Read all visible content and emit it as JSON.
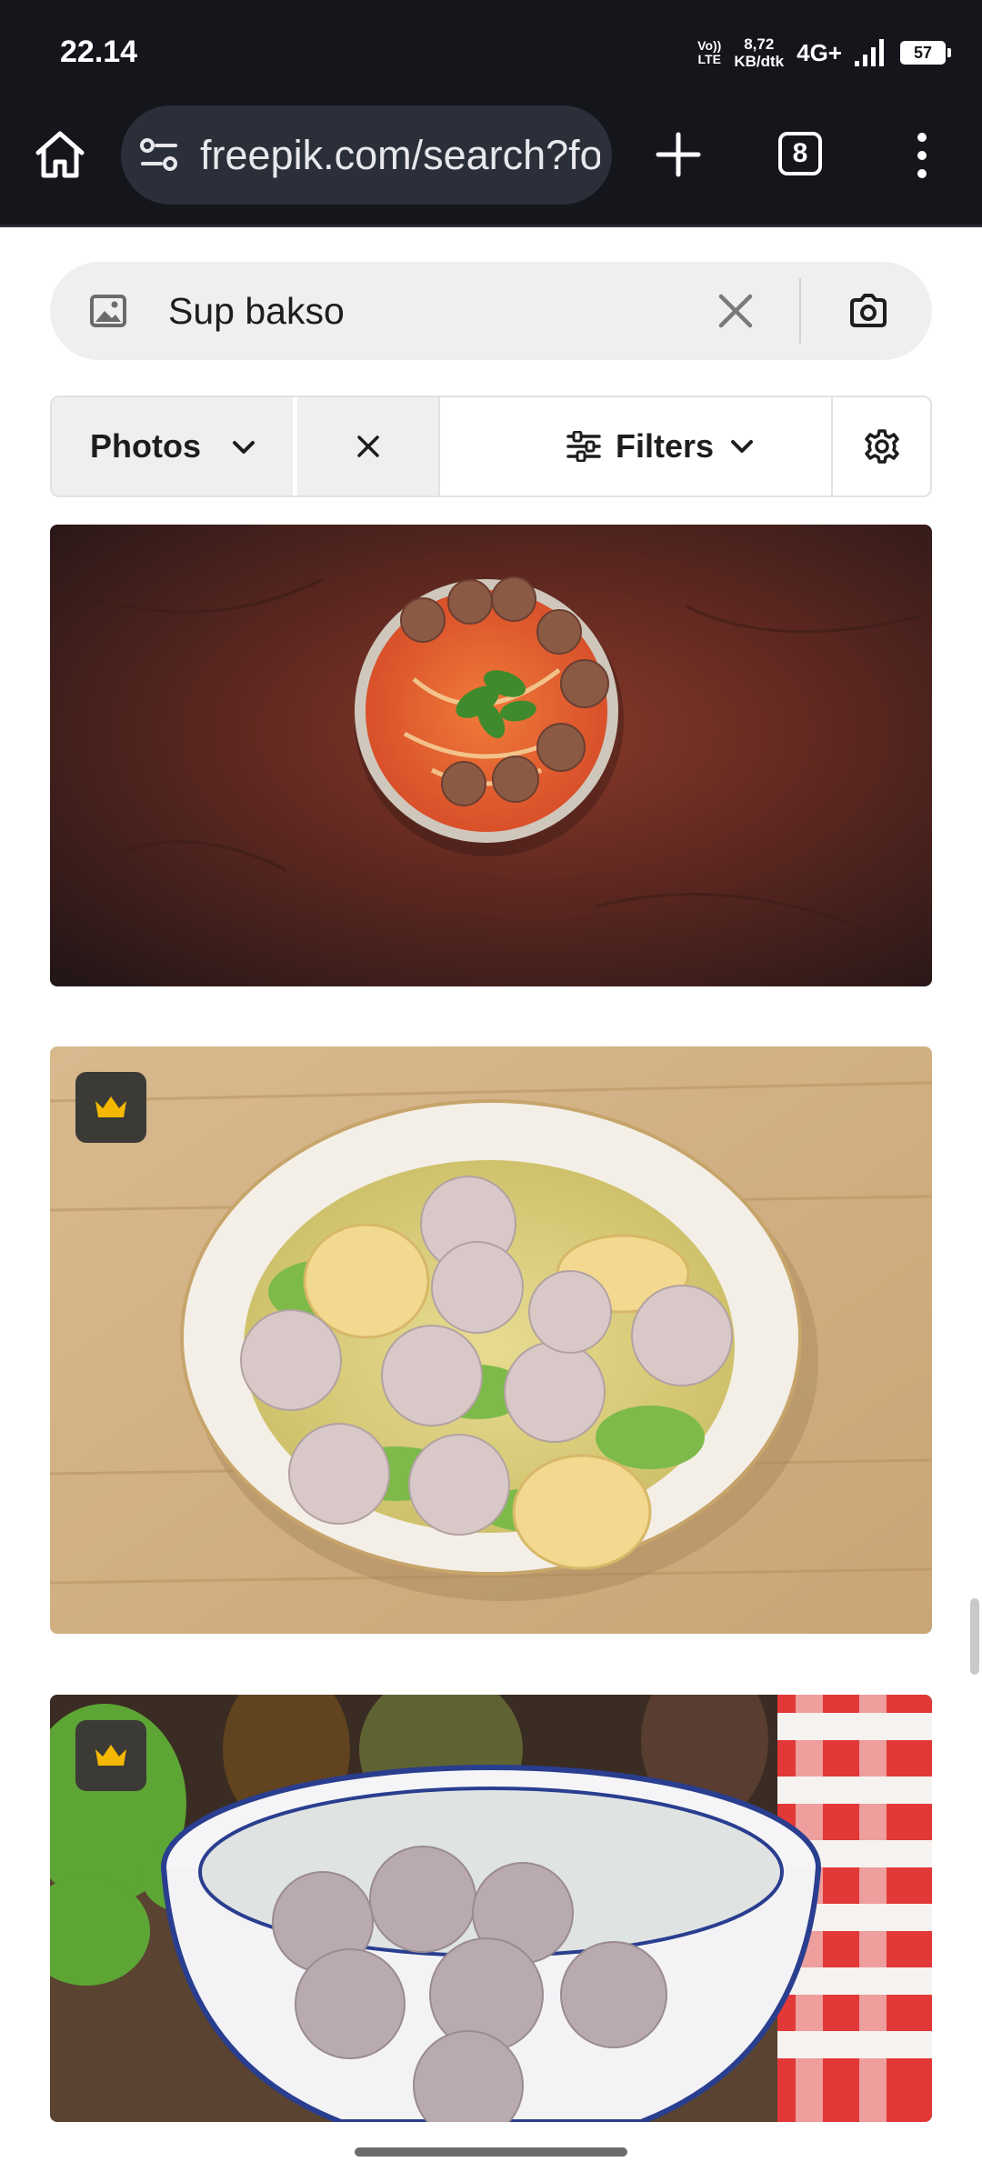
{
  "status_bar": {
    "time": "22.14",
    "volte_line1": "Vo))",
    "volte_line2": "LTE",
    "speed_line1": "8,72",
    "speed_line2": "KB/dtk",
    "network": "4G+",
    "battery": "57"
  },
  "browser": {
    "url": "freepik.com/search?format=search&query=Sup+bakso",
    "tab_count": "8",
    "icons": [
      "home-icon",
      "site-settings-icon",
      "plus-icon",
      "tabs-icon",
      "more-vert-icon"
    ]
  },
  "search": {
    "query": "Sup bakso",
    "icons": [
      "image-icon",
      "close-icon",
      "camera-icon"
    ]
  },
  "toolbar": {
    "type_label": "Photos",
    "filters_label": "Filters",
    "icons": [
      "chevron-down-icon",
      "close-icon",
      "sliders-icon",
      "gear-icon"
    ]
  },
  "results": [
    {
      "subject": "meatball soup with noodles on dark red table",
      "premium": false
    },
    {
      "subject": "meatball soup with egg tofu and cabbage on wooden table",
      "premium": true
    },
    {
      "subject": "clear meatball soup in blue rimmed bowl",
      "premium": true
    }
  ],
  "colors": {
    "chrome_bg": "#14161c",
    "url_pill": "#2b2f3a",
    "premium_badge": "#3b3a36",
    "crown": "#f5b800"
  }
}
